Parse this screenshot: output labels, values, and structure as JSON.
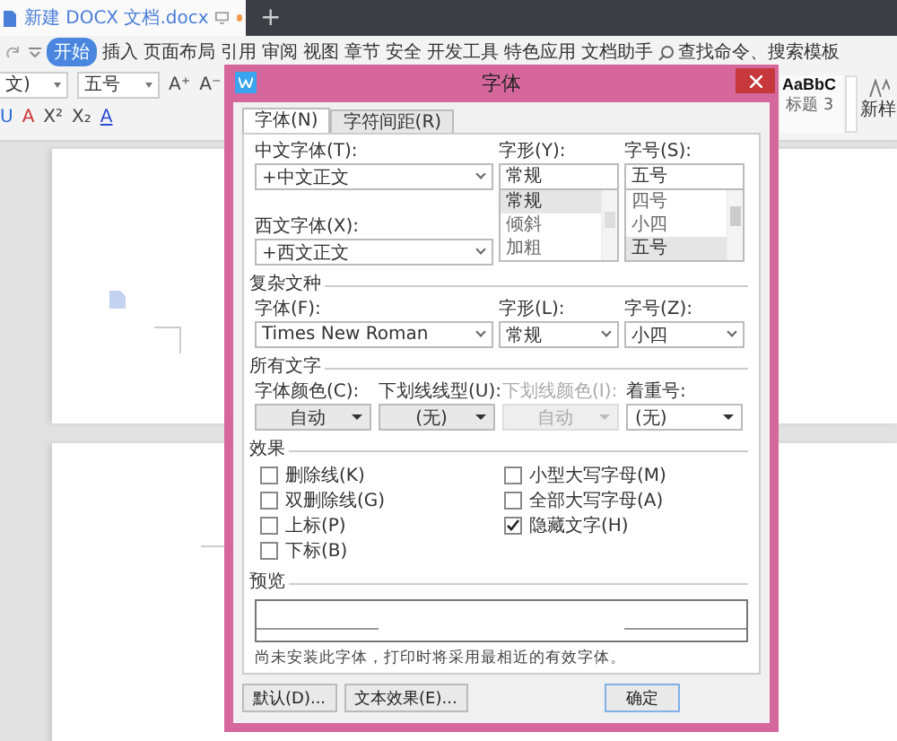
{
  "app_tabs": [
    {
      "title": "新建 DOCX 文档.docx",
      "selected": true
    }
  ],
  "new_tab": "+",
  "menu": [
    {
      "label": "开始",
      "selected": true
    },
    {
      "label": "插入",
      "selected": false
    },
    {
      "label": "页面布局",
      "selected": false
    },
    {
      "label": "引用",
      "selected": false
    },
    {
      "label": "审阅",
      "selected": false
    },
    {
      "label": "视图",
      "selected": false
    },
    {
      "label": "章节",
      "selected": false
    },
    {
      "label": "安全",
      "selected": false
    },
    {
      "label": "开发工具",
      "selected": false
    },
    {
      "label": "特色应用",
      "selected": false
    },
    {
      "label": "文档助手",
      "selected": false
    }
  ],
  "search": {
    "placeholder": "查找命令、搜索模板"
  },
  "ribbon": {
    "font_name": "文)",
    "font_size": "五号",
    "buttons_row1": [
      "A⁺",
      "A⁻"
    ],
    "buttons_row2": [
      "U",
      "A",
      "X²",
      "X₂",
      "A"
    ],
    "style_sample": "AaBbC",
    "style_name": "标题 3",
    "new_style": "新样"
  },
  "dialog": {
    "title": "字体",
    "tabs": [
      {
        "label": "字体(N)",
        "selected": true
      },
      {
        "label": "字符间距(R)",
        "selected": false
      }
    ],
    "chinese_font": {
      "label": "中文字体(T):",
      "value": "+中文正文"
    },
    "western_font": {
      "label": "西文字体(X):",
      "value": "+西文正文"
    },
    "style": {
      "label": "字形(Y):",
      "value": "常规",
      "options": [
        {
          "label": "常规",
          "selected": true
        },
        {
          "label": "倾斜",
          "selected": false
        },
        {
          "label": "加粗",
          "selected": false
        }
      ]
    },
    "size": {
      "label": "字号(S):",
      "value": "五号",
      "options": [
        {
          "label": "四号",
          "selected": false
        },
        {
          "label": "小四",
          "selected": false
        },
        {
          "label": "五号",
          "selected": true
        }
      ]
    },
    "complex_group": "复杂文种",
    "complex_fields": [
      {
        "label": "字体(F):",
        "value": "Times New Roman"
      },
      {
        "label": "字形(L):",
        "value": "常规"
      },
      {
        "label": "字号(Z):",
        "value": "小四"
      }
    ],
    "all_text_group": "所有文字",
    "all_text_fields": [
      {
        "label": "字体颜色(C):",
        "value": "自动",
        "disabled": false,
        "kind": "center"
      },
      {
        "label": "下划线线型(U):",
        "value": "(无)",
        "disabled": false,
        "kind": "center"
      },
      {
        "label": "下划线颜色(I):",
        "value": "自动",
        "disabled": true,
        "kind": "center"
      },
      {
        "label": "着重号:",
        "value": "(无)",
        "disabled": false,
        "kind": "left"
      }
    ],
    "effects_group": "效果",
    "effects_left": [
      {
        "label": "删除线(K)",
        "checked": false
      },
      {
        "label": "双删除线(G)",
        "checked": false
      },
      {
        "label": "上标(P)",
        "checked": false
      },
      {
        "label": "下标(B)",
        "checked": false
      }
    ],
    "effects_right": [
      {
        "label": "小型大写字母(M)",
        "checked": false
      },
      {
        "label": "全部大写字母(A)",
        "checked": false
      },
      {
        "label": "隐藏文字(H)",
        "checked": true
      }
    ],
    "preview_group": "预览",
    "note": "尚未安装此字体，打印时将采用最相近的有效字体。",
    "buttons": [
      "默认(D)...",
      "文本效果(E)...",
      "确定"
    ]
  }
}
